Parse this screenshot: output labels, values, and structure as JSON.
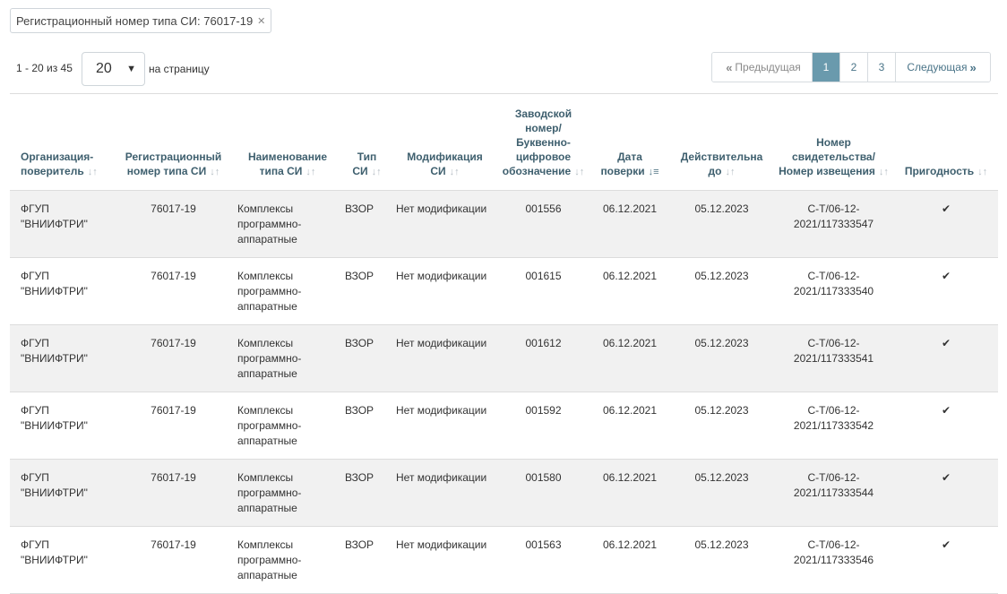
{
  "filter_chip": {
    "label": "Регистрационный номер типа СИ: 76017-19",
    "remove_icon": "close-icon"
  },
  "summary": {
    "range_text": "1 - 20 из 45",
    "per_page_value": "20",
    "per_page_label": "на страницу"
  },
  "pagination": {
    "prev_label": "Предыдущая",
    "next_label": "Следующая",
    "pages": [
      "1",
      "2",
      "3"
    ],
    "active_page": "1"
  },
  "columns": {
    "org": "Организация-поверитель",
    "reg": "Регистрационный номер типа СИ",
    "name": "Наименование типа СИ",
    "type": "Тип СИ",
    "mod": "Модификация СИ",
    "serial": "Заводской номер/ Буквенно-цифровое обозначение",
    "date": "Дата поверки",
    "valid": "Действительна до",
    "cert": "Номер свидетельства/ Номер извещения",
    "fit": "Пригодность"
  },
  "rows": [
    {
      "org": "ФГУП \"ВНИИФТРИ\"",
      "reg": "76017-19",
      "name": "Комплексы программно-аппаратные",
      "type": "ВЗОР",
      "mod": "Нет модификации",
      "serial": "001556",
      "date": "06.12.2021",
      "valid": "05.12.2023",
      "cert": "С-Т/06-12-2021/117333547",
      "fit": "✔"
    },
    {
      "org": "ФГУП \"ВНИИФТРИ\"",
      "reg": "76017-19",
      "name": "Комплексы программно-аппаратные",
      "type": "ВЗОР",
      "mod": "Нет модификации",
      "serial": "001615",
      "date": "06.12.2021",
      "valid": "05.12.2023",
      "cert": "С-Т/06-12-2021/117333540",
      "fit": "✔"
    },
    {
      "org": "ФГУП \"ВНИИФТРИ\"",
      "reg": "76017-19",
      "name": "Комплексы программно-аппаратные",
      "type": "ВЗОР",
      "mod": "Нет модификации",
      "serial": "001612",
      "date": "06.12.2021",
      "valid": "05.12.2023",
      "cert": "С-Т/06-12-2021/117333541",
      "fit": "✔"
    },
    {
      "org": "ФГУП \"ВНИИФТРИ\"",
      "reg": "76017-19",
      "name": "Комплексы программно-аппаратные",
      "type": "ВЗОР",
      "mod": "Нет модификации",
      "serial": "001592",
      "date": "06.12.2021",
      "valid": "05.12.2023",
      "cert": "С-Т/06-12-2021/117333542",
      "fit": "✔"
    },
    {
      "org": "ФГУП \"ВНИИФТРИ\"",
      "reg": "76017-19",
      "name": "Комплексы программно-аппаратные",
      "type": "ВЗОР",
      "mod": "Нет модификации",
      "serial": "001580",
      "date": "06.12.2021",
      "valid": "05.12.2023",
      "cert": "С-Т/06-12-2021/117333544",
      "fit": "✔"
    },
    {
      "org": "ФГУП \"ВНИИФТРИ\"",
      "reg": "76017-19",
      "name": "Комплексы программно-аппаратные",
      "type": "ВЗОР",
      "mod": "Нет модификации",
      "serial": "001563",
      "date": "06.12.2021",
      "valid": "05.12.2023",
      "cert": "С-Т/06-12-2021/117333546",
      "fit": "✔"
    }
  ]
}
